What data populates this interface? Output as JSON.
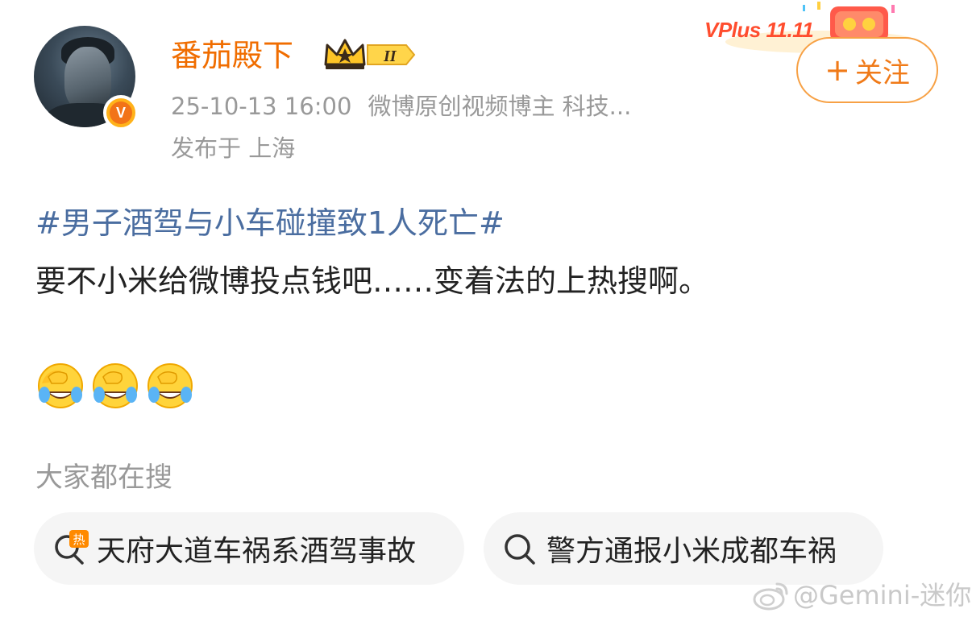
{
  "post": {
    "author": {
      "name": "番茄殿下",
      "verified_mark": "V",
      "level_badge": "II"
    },
    "time": "25-10-13 16:00",
    "source": "微博原创视频博主 科技...",
    "location": "发布于 上海",
    "topic": "#男子酒驾与小车碰撞致1人死亡#",
    "text": "要不小米给微博投点钱吧……变着法的上热搜啊。",
    "emojis": [
      "laugh-cry-emoji",
      "laugh-cry-emoji",
      "laugh-cry-emoji"
    ]
  },
  "header": {
    "promo_text": "VPlus 11.11",
    "follow_label": "关注",
    "follow_icon": "plus-icon"
  },
  "search_section": {
    "label": "大家都在搜",
    "chips": [
      {
        "label": "天府大道车祸系酒驾事故",
        "icon": "hot-search-icon",
        "icon_text": "热"
      },
      {
        "label": "警方通报小米成都车祸",
        "icon": "search-icon"
      }
    ]
  },
  "watermark": {
    "text": "@Gemini-迷你",
    "icon": "weibo-logo-icon"
  },
  "colors": {
    "username": "#f06d00",
    "topic": "#4a6da0",
    "follow_border": "#f7a145",
    "meta": "#999999",
    "chip_bg": "#f5f5f5"
  }
}
